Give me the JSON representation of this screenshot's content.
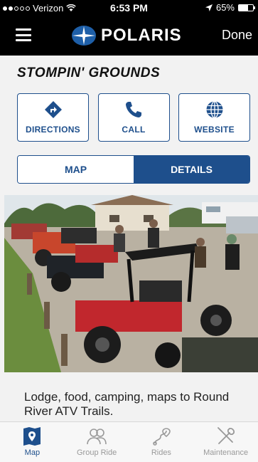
{
  "status_bar": {
    "carrier": "Verizon",
    "time": "6:53 PM",
    "battery_percent": "65%",
    "battery_level": 0.65,
    "signal_bars_filled": 2,
    "signal_bars_total": 5
  },
  "nav": {
    "brand": "POLARIS",
    "done_label": "Done"
  },
  "place": {
    "title": "STOMPIN' GROUNDS",
    "description": "Lodge, food, camping, maps to Round River ATV Trails."
  },
  "actions": [
    {
      "label": "DIRECTIONS",
      "icon": "directions-icon"
    },
    {
      "label": "CALL",
      "icon": "phone-icon"
    },
    {
      "label": "WEBSITE",
      "icon": "globe-icon"
    }
  ],
  "segment": {
    "map_label": "MAP",
    "details_label": "DETAILS",
    "selected": "details"
  },
  "tabs": [
    {
      "label": "Map",
      "icon": "map-icon",
      "active": true
    },
    {
      "label": "Group Ride",
      "icon": "group-ride-icon",
      "active": false
    },
    {
      "label": "Rides",
      "icon": "rides-icon",
      "active": false
    },
    {
      "label": "Maintenance",
      "icon": "maintenance-icon",
      "active": false
    }
  ],
  "colors": {
    "brand_blue": "#1e4f8c",
    "background": "#f2f2f2",
    "header": "#000000"
  }
}
